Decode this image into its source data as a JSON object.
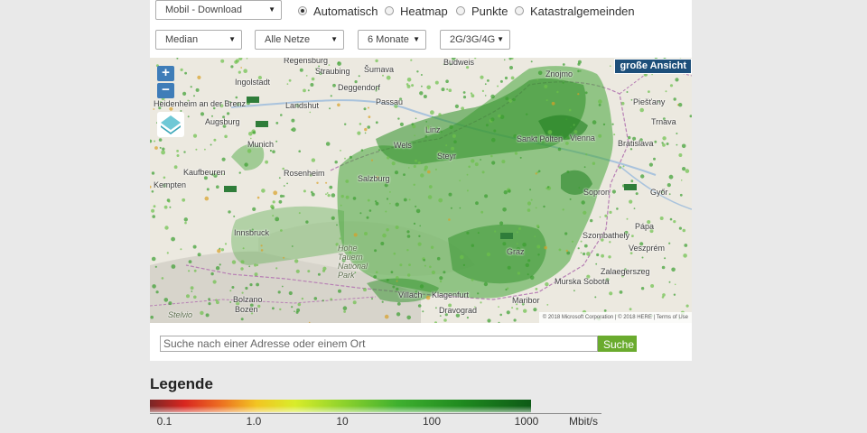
{
  "filters": {
    "mode": {
      "value": "Mobil - Download"
    },
    "statistic": {
      "value": "Median"
    },
    "network": {
      "value": "Alle Netze"
    },
    "period": {
      "value": "6 Monate"
    },
    "technology": {
      "value": "2G/3G/4G"
    }
  },
  "view_options": [
    {
      "label": "Automatisch",
      "selected": true
    },
    {
      "label": "Heatmap",
      "selected": false
    },
    {
      "label": "Punkte",
      "selected": false
    },
    {
      "label": "Katastralgemeinden",
      "selected": false
    }
  ],
  "map": {
    "zoom_in": "+",
    "zoom_out": "−",
    "big_view_label": "große Ansicht",
    "attribution": "© 2018 Microsoft Corporation  |  © 2018 HERE  |  Terms of Use",
    "labels": {
      "regensburg": "Regensburg",
      "straubing": "Straubing",
      "sumava": "Šumava",
      "budweis": "Budweis",
      "znojmo": "Znojmo",
      "ingolstadt": "Ingolstadt",
      "deggendorf": "Deggendorf",
      "passau": "Passau",
      "heidenheim": "Heidenheim an der Brenz",
      "landshut": "Landshut",
      "linz": "Linz",
      "piestany": "Piešťany",
      "augsburg": "Augsburg",
      "trnava": "Trnava",
      "munich": "Munich",
      "stpoelten": "Sankt Pölten",
      "vienna": "Vienna",
      "wels": "Wels",
      "steyr": "Steyr",
      "bratislava": "Bratislava",
      "kaufbeuren": "Kaufbeuren",
      "rosenheim": "Rosenheim",
      "salzburg": "Salzburg",
      "kempten": "Kempten",
      "sopron": "Sopron",
      "gyor": "Győr",
      "papa": "Pápa",
      "innsbruck": "Innsbruck",
      "szombathely": "Szombathely",
      "veszprem": "Veszprém",
      "hohetauern": "Hohe Tauern National Park",
      "graz": "Graz",
      "zalaegerszeg": "Zalaegerszeg",
      "villach": "Villach",
      "klagenfurt": "Klagenfurt",
      "murska": "Murska Sobota",
      "bolzano": "Bolzano",
      "bozen": "Bozen",
      "maribor": "Maribor",
      "dravograd": "Dravograd",
      "stelvio": "Stelvio"
    }
  },
  "search": {
    "placeholder": "Suche nach einer Adresse oder einem Ort",
    "button_label": "Suche"
  },
  "legend": {
    "title": "Legende",
    "ticks": [
      "0.1",
      "1.0",
      "10",
      "100",
      "1000"
    ],
    "unit": "Mbit/s"
  },
  "colors": {
    "coverage_green": "#3a9e2f",
    "zoom_blue": "#3f7db8",
    "big_view_blue": "#1d4f7a",
    "search_green": "#6aab2e"
  }
}
